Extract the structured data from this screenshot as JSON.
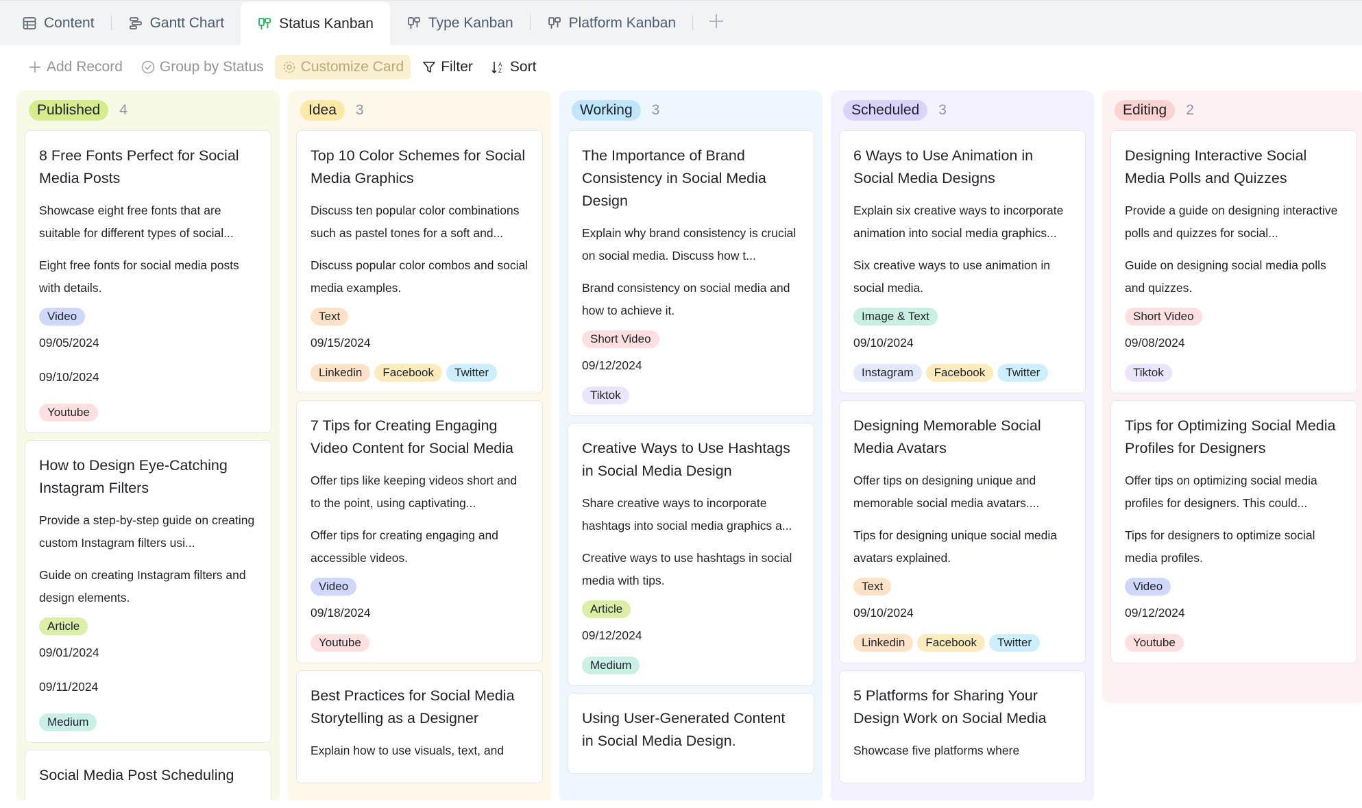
{
  "tabs": [
    {
      "label": "Content",
      "icon": "table-icon"
    },
    {
      "label": "Gantt Chart",
      "icon": "gantt-icon"
    },
    {
      "label": "Status Kanban",
      "icon": "kanban-icon",
      "active": true
    },
    {
      "label": "Type Kanban",
      "icon": "kanban-icon"
    },
    {
      "label": "Platform Kanban",
      "icon": "kanban-icon"
    }
  ],
  "toolbar": {
    "add_record": "Add Record",
    "group_by": "Group by Status",
    "customize": "Customize Card",
    "filter": "Filter",
    "sort": "Sort"
  },
  "colors": {
    "published_bg": "#f7fae6",
    "published_pill": "#d6ec8d",
    "idea_bg": "#fdf8ea",
    "idea_pill": "#fde9a5",
    "working_bg": "#edf7fd",
    "working_pill": "#bfe6fb",
    "scheduled_bg": "#f4f3fd",
    "scheduled_pill": "#dcd3fb",
    "editing_bg": "#fef1f1",
    "editing_pill": "#fcd3d1"
  },
  "columns": [
    {
      "status": "Published",
      "count": "4",
      "cards": [
        {
          "title": "8 Free Fonts Perfect for Social Media Posts",
          "desc": "Showcase eight free fonts that are suitable for different types of social...",
          "summary": "Eight free fonts for social media posts with details.",
          "type": "Video",
          "date1": "09/05/2024",
          "date2": "09/10/2024",
          "platforms": [
            "Youtube"
          ]
        },
        {
          "title": "How to Design Eye-Catching Instagram Filters",
          "desc": "Provide a step-by-step guide on creating custom Instagram filters usi...",
          "summary": "Guide on creating Instagram filters and design elements.",
          "type": "Article",
          "date1": "09/01/2024",
          "date2": "09/11/2024",
          "platforms": [
            "Medium"
          ]
        },
        {
          "title": "Social Media Post Scheduling"
        }
      ]
    },
    {
      "status": "Idea",
      "count": "3",
      "cards": [
        {
          "title": "Top 10 Color Schemes for Social Media Graphics",
          "desc": "Discuss ten popular color combinations such as pastel tones for a soft and...",
          "summary": "Discuss popular color combos and social media examples.",
          "type": "Text",
          "date1": "09/15/2024",
          "platforms": [
            "Linkedin",
            "Facebook",
            "Twitter"
          ]
        },
        {
          "title": "7 Tips for Creating Engaging Video Content for Social Media",
          "desc": "Offer tips like keeping videos short and to the point, using captivating...",
          "summary": "Offer tips for creating engaging and accessible videos.",
          "type": "Video",
          "date1": "09/18/2024",
          "platforms": [
            "Youtube"
          ]
        },
        {
          "title": "Best Practices for Social Media Storytelling as a Designer",
          "desc": "Explain how to use visuals, text, and"
        }
      ]
    },
    {
      "status": "Working",
      "count": "3",
      "cards": [
        {
          "title": "The Importance of Brand Consistency in Social Media Design",
          "desc": "Explain why brand consistency is crucial on social media. Discuss how t...",
          "summary": "Brand consistency on social media and how to achieve it.",
          "type": "Short Video",
          "date1": "09/12/2024",
          "platforms": [
            "Tiktok"
          ]
        },
        {
          "title": "Creative Ways to Use Hashtags in Social Media Design",
          "desc": "Share creative ways to incorporate hashtags into social media graphics a...",
          "summary": "Creative ways to use hashtags in social media with tips.",
          "type": "Article",
          "date1": "09/12/2024",
          "platforms": [
            "Medium"
          ]
        },
        {
          "title": "Using User-Generated Content in Social Media Design."
        }
      ]
    },
    {
      "status": "Scheduled",
      "count": "3",
      "cards": [
        {
          "title": "6 Ways to Use Animation in Social Media Designs",
          "desc": "Explain six creative ways to incorporate animation into social media graphics...",
          "summary": "Six creative ways to use animation in social media.",
          "type": "Image & Text",
          "date1": "09/10/2024",
          "platforms": [
            "Instagram",
            "Facebook",
            "Twitter"
          ]
        },
        {
          "title": "Designing Memorable Social Media Avatars",
          "desc": "Offer tips on designing unique and memorable social media avatars....",
          "summary": "Tips for designing unique social media avatars explained.",
          "type": "Text",
          "date1": "09/10/2024",
          "platforms": [
            "Linkedin",
            "Facebook",
            "Twitter"
          ]
        },
        {
          "title": "5 Platforms for Sharing Your Design Work on Social Media",
          "desc": "Showcase five platforms where"
        }
      ]
    },
    {
      "status": "Editing",
      "count": "2",
      "cards": [
        {
          "title": "Designing Interactive Social Media Polls and Quizzes",
          "desc": "Provide a guide on designing interactive polls and quizzes for social...",
          "summary": "Guide on designing social media polls and quizzes.",
          "type": "Short Video",
          "date1": "09/08/2024",
          "platforms": [
            "Tiktok"
          ]
        },
        {
          "title": "Tips for Optimizing Social Media Profiles for Designers",
          "desc": "Offer tips on optimizing social media profiles for designers. This could...",
          "summary": "Tips for designers to optimize social media profiles.",
          "type": "Video",
          "date1": "09/12/2024",
          "platforms": [
            "Youtube"
          ]
        }
      ]
    }
  ],
  "tag_colors": {
    "Video": "#cfd8fb",
    "Text": "#fde2c8",
    "Article": "#dbefa6",
    "Short Video": "#fde0df",
    "Image & Text": "#c8efe2",
    "Youtube": "#fde0df",
    "Medium": "#c9efe6",
    "Linkedin": "#fde2c8",
    "Facebook": "#fcebbd",
    "Twitter": "#cdeefc",
    "Tiktok": "#ece4fb",
    "Instagram": "#e2e9fb"
  }
}
